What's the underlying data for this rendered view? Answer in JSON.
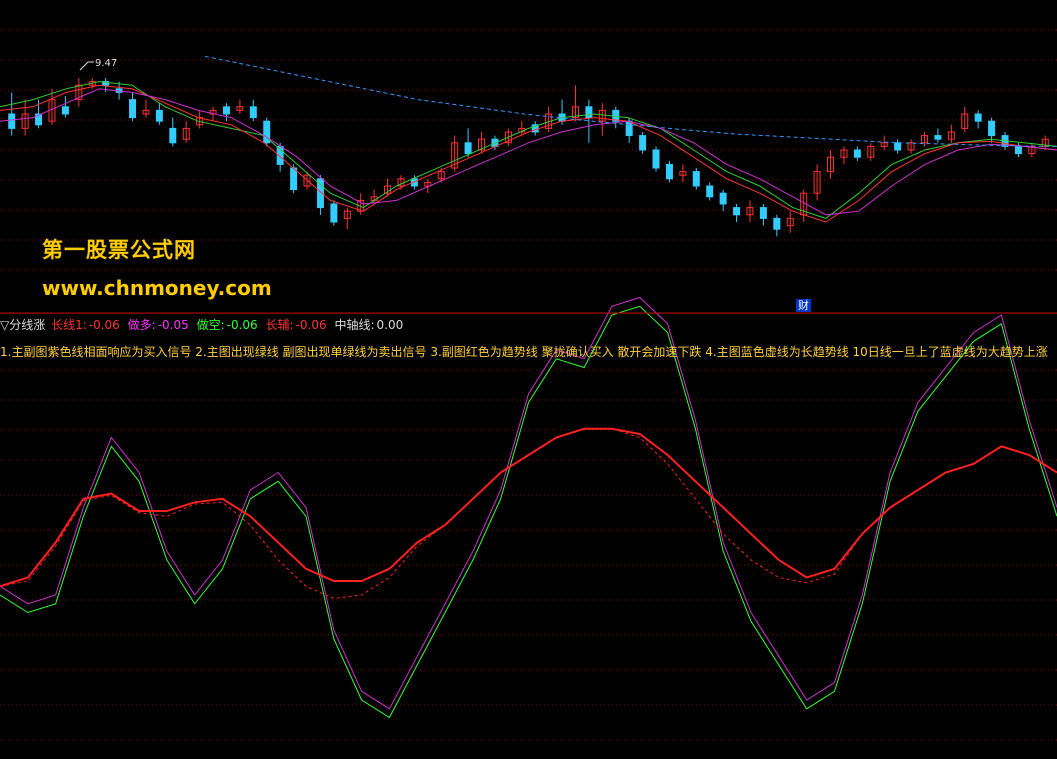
{
  "watermark": {
    "title": "第一股票公式网",
    "url": "www.chnmoney.com"
  },
  "top_panel": {
    "max_price_label": "9.47",
    "event_badge": "财"
  },
  "legend": {
    "name": "▽分线涨",
    "items": [
      {
        "label": "长线1:",
        "value": "-0.06",
        "color": "#FF3333"
      },
      {
        "label": "做多:",
        "value": "-0.05",
        "color": "#FF33FF"
      },
      {
        "label": "做空:",
        "value": "-0.06",
        "color": "#33FF33"
      },
      {
        "label": "长辅:",
        "value": "-0.06",
        "color": "#FF3333"
      },
      {
        "label": "中轴线:",
        "value": "0.00",
        "color": "#DDDDDD"
      }
    ]
  },
  "notes": "1.主副图紫色线相面响应为买入信号  2.主图出现绿线 副图出现单绿线为卖出信号  3.副图红色为趋势线 聚拢确认买入 散开会加速下跌  4.主图蓝色虚线为长趋势线 10日线一旦上了蓝虚线为大趋势上涨",
  "colors": {
    "up": "#FF3333",
    "down": "#33CCFF",
    "grid": "#8B0000",
    "trend_blue": "#3399FF",
    "green": "#33CC33",
    "purple": "#CC33CC",
    "red": "#FF2020",
    "yellow_green": "#CCFF33"
  },
  "chart_data": [
    {
      "type": "candlestick",
      "title": "",
      "annotations": [
        "9.47",
        "财"
      ],
      "grid": true,
      "series": [
        {
          "kind": "candles",
          "values": [
            [
              0.5,
              0.3,
              0.8,
              0.2
            ],
            [
              0.3,
              0.5,
              0.7,
              0.2
            ],
            [
              0.5,
              0.35,
              0.7,
              0.3
            ],
            [
              0.4,
              0.7,
              0.85,
              0.35
            ],
            [
              0.6,
              0.5,
              0.75,
              0.45
            ],
            [
              0.7,
              0.9,
              1.0,
              0.6
            ],
            [
              0.9,
              0.95,
              1.0,
              0.85
            ],
            [
              0.95,
              0.9,
              1.0,
              0.8
            ],
            [
              0.85,
              0.8,
              0.95,
              0.7
            ],
            [
              0.7,
              0.45,
              0.8,
              0.4
            ],
            [
              0.5,
              0.55,
              0.7,
              0.45
            ],
            [
              0.55,
              0.4,
              0.65,
              0.35
            ],
            [
              0.3,
              0.1,
              0.45,
              0.05
            ],
            [
              0.15,
              0.3,
              0.4,
              0.1
            ],
            [
              0.35,
              0.45,
              0.55,
              0.3
            ],
            [
              0.5,
              0.55,
              0.6,
              0.4
            ],
            [
              0.6,
              0.5,
              0.65,
              0.4
            ],
            [
              0.55,
              0.6,
              0.7,
              0.5
            ],
            [
              0.6,
              0.45,
              0.7,
              0.4
            ],
            [
              0.4,
              0.1,
              0.45,
              0.05
            ],
            [
              0.05,
              -0.2,
              0.1,
              -0.3
            ],
            [
              -0.25,
              -0.55,
              -0.2,
              -0.6
            ],
            [
              -0.5,
              -0.35,
              -0.3,
              -0.55
            ],
            [
              -0.4,
              -0.8,
              -0.35,
              -0.9
            ],
            [
              -0.75,
              -1.0,
              -0.7,
              -1.05
            ],
            [
              -0.95,
              -0.85,
              -0.8,
              -1.1
            ],
            [
              -0.85,
              -0.7,
              -0.6,
              -0.9
            ],
            [
              -0.7,
              -0.65,
              -0.55,
              -0.75
            ],
            [
              -0.6,
              -0.5,
              -0.4,
              -0.65
            ],
            [
              -0.5,
              -0.4,
              -0.35,
              -0.55
            ],
            [
              -0.4,
              -0.5,
              -0.35,
              -0.55
            ],
            [
              -0.5,
              -0.45,
              -0.4,
              -0.6
            ],
            [
              -0.4,
              -0.3,
              -0.25,
              -0.45
            ],
            [
              -0.25,
              0.1,
              0.2,
              -0.3
            ],
            [
              0.1,
              -0.05,
              0.3,
              -0.1
            ],
            [
              0.0,
              0.15,
              0.25,
              -0.05
            ],
            [
              0.15,
              0.05,
              0.2,
              0.0
            ],
            [
              0.1,
              0.25,
              0.3,
              0.05
            ],
            [
              0.25,
              0.3,
              0.4,
              0.2
            ],
            [
              0.35,
              0.25,
              0.4,
              0.2
            ],
            [
              0.3,
              0.5,
              0.6,
              0.25
            ],
            [
              0.5,
              0.4,
              0.7,
              0.35
            ],
            [
              0.45,
              0.6,
              0.9,
              0.4
            ],
            [
              0.6,
              0.45,
              0.7,
              0.1
            ],
            [
              0.4,
              0.55,
              0.65,
              0.2
            ],
            [
              0.55,
              0.4,
              0.6,
              0.3
            ],
            [
              0.4,
              0.2,
              0.45,
              0.1
            ],
            [
              0.2,
              0.0,
              0.25,
              -0.05
            ],
            [
              0.0,
              -0.25,
              0.05,
              -0.3
            ],
            [
              -0.2,
              -0.4,
              -0.15,
              -0.45
            ],
            [
              -0.35,
              -0.3,
              -0.2,
              -0.45
            ],
            [
              -0.3,
              -0.5,
              -0.25,
              -0.55
            ],
            [
              -0.5,
              -0.65,
              -0.45,
              -0.7
            ],
            [
              -0.6,
              -0.75,
              -0.55,
              -0.85
            ],
            [
              -0.8,
              -0.9,
              -0.75,
              -1.0
            ],
            [
              -0.9,
              -0.8,
              -0.7,
              -1.0
            ],
            [
              -0.8,
              -0.95,
              -0.75,
              -1.05
            ],
            [
              -0.95,
              -1.1,
              -0.9,
              -1.2
            ],
            [
              -1.05,
              -0.95,
              -0.85,
              -1.15
            ],
            [
              -0.9,
              -0.6,
              -0.55,
              -1.0
            ],
            [
              -0.6,
              -0.3,
              -0.2,
              -0.7
            ],
            [
              -0.3,
              -0.1,
              0.0,
              -0.4
            ],
            [
              -0.1,
              0.0,
              0.05,
              -0.2
            ],
            [
              0.0,
              -0.1,
              0.05,
              -0.15
            ],
            [
              -0.1,
              0.05,
              0.1,
              -0.15
            ],
            [
              0.05,
              0.1,
              0.2,
              0.0
            ],
            [
              0.1,
              0.0,
              0.15,
              -0.05
            ],
            [
              0.0,
              0.1,
              0.15,
              -0.05
            ],
            [
              0.1,
              0.2,
              0.25,
              0.05
            ],
            [
              0.2,
              0.15,
              0.3,
              0.1
            ],
            [
              0.15,
              0.25,
              0.35,
              0.1
            ],
            [
              0.3,
              0.5,
              0.6,
              0.25
            ],
            [
              0.5,
              0.4,
              0.55,
              0.3
            ],
            [
              0.4,
              0.2,
              0.45,
              0.1
            ],
            [
              0.2,
              0.05,
              0.25,
              0.0
            ],
            [
              0.05,
              -0.05,
              0.1,
              -0.1
            ],
            [
              -0.05,
              0.05,
              0.1,
              -0.1
            ],
            [
              0.05,
              0.15,
              0.2,
              0.0
            ]
          ]
        },
        {
          "kind": "line",
          "name": "",
          "color": "#33CC33",
          "values": [
            0.6,
            0.7,
            0.85,
            0.95,
            0.9,
            0.6,
            0.4,
            0.3,
            0.2,
            -0.2,
            -0.6,
            -0.8,
            -0.5,
            -0.3,
            -0.1,
            0.1,
            0.3,
            0.45,
            0.5,
            0.45,
            0.3,
            0.0,
            -0.3,
            -0.5,
            -0.8,
            -0.95,
            -0.6,
            -0.2,
            0.0,
            0.1,
            0.15,
            0.1,
            0.05
          ]
        },
        {
          "kind": "line",
          "name": "",
          "color": "#FF3333",
          "values": [
            0.55,
            0.6,
            0.8,
            0.9,
            0.85,
            0.65,
            0.45,
            0.35,
            0.1,
            -0.3,
            -0.7,
            -0.85,
            -0.55,
            -0.35,
            -0.15,
            0.05,
            0.25,
            0.4,
            0.45,
            0.4,
            0.2,
            -0.1,
            -0.4,
            -0.6,
            -0.85,
            -1.0,
            -0.7,
            -0.3,
            -0.05,
            0.1,
            0.12,
            0.05,
            0.0
          ]
        },
        {
          "kind": "line",
          "name": "",
          "color": "#CC33CC",
          "values": [
            0.4,
            0.45,
            0.65,
            0.85,
            0.8,
            0.7,
            0.55,
            0.45,
            0.2,
            -0.1,
            -0.5,
            -0.75,
            -0.7,
            -0.5,
            -0.3,
            -0.1,
            0.1,
            0.25,
            0.35,
            0.4,
            0.3,
            0.1,
            -0.2,
            -0.4,
            -0.65,
            -0.9,
            -0.85,
            -0.5,
            -0.2,
            0.0,
            0.08,
            0.05,
            0.0
          ]
        },
        {
          "kind": "line",
          "name": "",
          "color": "#3399FF",
          "dashed": true,
          "values": [
            1.3,
            1.15,
            1.0,
            0.85,
            0.7,
            0.6,
            0.5,
            0.42,
            0.35,
            0.28,
            0.22,
            0.18,
            0.14,
            0.1,
            0.08,
            0.06,
            0.05
          ]
        }
      ]
    },
    {
      "type": "line",
      "title": "",
      "ylim": [
        -1,
        1
      ],
      "grid": true,
      "series": [
        {
          "name": "做多",
          "color": "#CC33CC",
          "values": [
            -0.35,
            -0.45,
            -0.4,
            0.1,
            0.5,
            0.3,
            -0.15,
            -0.4,
            -0.2,
            0.2,
            0.3,
            0.1,
            -0.6,
            -0.95,
            -1.05,
            -0.75,
            -0.45,
            -0.15,
            0.2,
            0.75,
            1.0,
            0.95,
            1.25,
            1.3,
            1.15,
            0.6,
            -0.1,
            -0.5,
            -0.75,
            -1.0,
            -0.9,
            -0.4,
            0.3,
            0.7,
            0.9,
            1.1,
            1.2,
            0.6,
            0.1
          ]
        },
        {
          "name": "做空",
          "color": "#33FF33",
          "values": [
            -0.4,
            -0.5,
            -0.45,
            0.05,
            0.45,
            0.25,
            -0.2,
            -0.45,
            -0.25,
            0.15,
            0.25,
            0.05,
            -0.65,
            -1.0,
            -1.1,
            -0.8,
            -0.5,
            -0.2,
            0.15,
            0.7,
            0.95,
            0.9,
            1.2,
            1.25,
            1.1,
            0.55,
            -0.15,
            -0.55,
            -0.8,
            -1.05,
            -0.95,
            -0.45,
            0.25,
            0.65,
            0.85,
            1.05,
            1.15,
            0.55,
            0.05
          ]
        },
        {
          "name": "长线1",
          "color": "#FF2020",
          "values": [
            -0.35,
            -0.3,
            -0.1,
            0.15,
            0.18,
            0.08,
            0.08,
            0.13,
            0.15,
            0.05,
            -0.1,
            -0.25,
            -0.32,
            -0.32,
            -0.25,
            -0.1,
            0.0,
            0.15,
            0.3,
            0.4,
            0.5,
            0.55,
            0.55,
            0.52,
            0.4,
            0.25,
            0.1,
            -0.05,
            -0.2,
            -0.3,
            -0.25,
            -0.05,
            0.1,
            0.2,
            0.3,
            0.35,
            0.45,
            0.4,
            0.3
          ]
        },
        {
          "name": "长辅",
          "color": "#FF2020",
          "dashed": true,
          "values": [
            -0.35,
            -0.32,
            -0.12,
            0.14,
            0.17,
            0.07,
            0.05,
            0.12,
            0.13,
            0.0,
            -0.2,
            -0.35,
            -0.42,
            -0.4,
            -0.3,
            -0.12,
            0.0,
            0.15,
            0.3,
            0.4,
            0.5,
            0.55,
            0.55,
            0.5,
            0.35,
            0.15,
            -0.05,
            -0.2,
            -0.3,
            -0.33,
            -0.28,
            -0.05,
            0.1,
            0.2,
            0.3,
            0.35,
            0.45,
            0.4,
            0.3
          ]
        }
      ]
    }
  ]
}
